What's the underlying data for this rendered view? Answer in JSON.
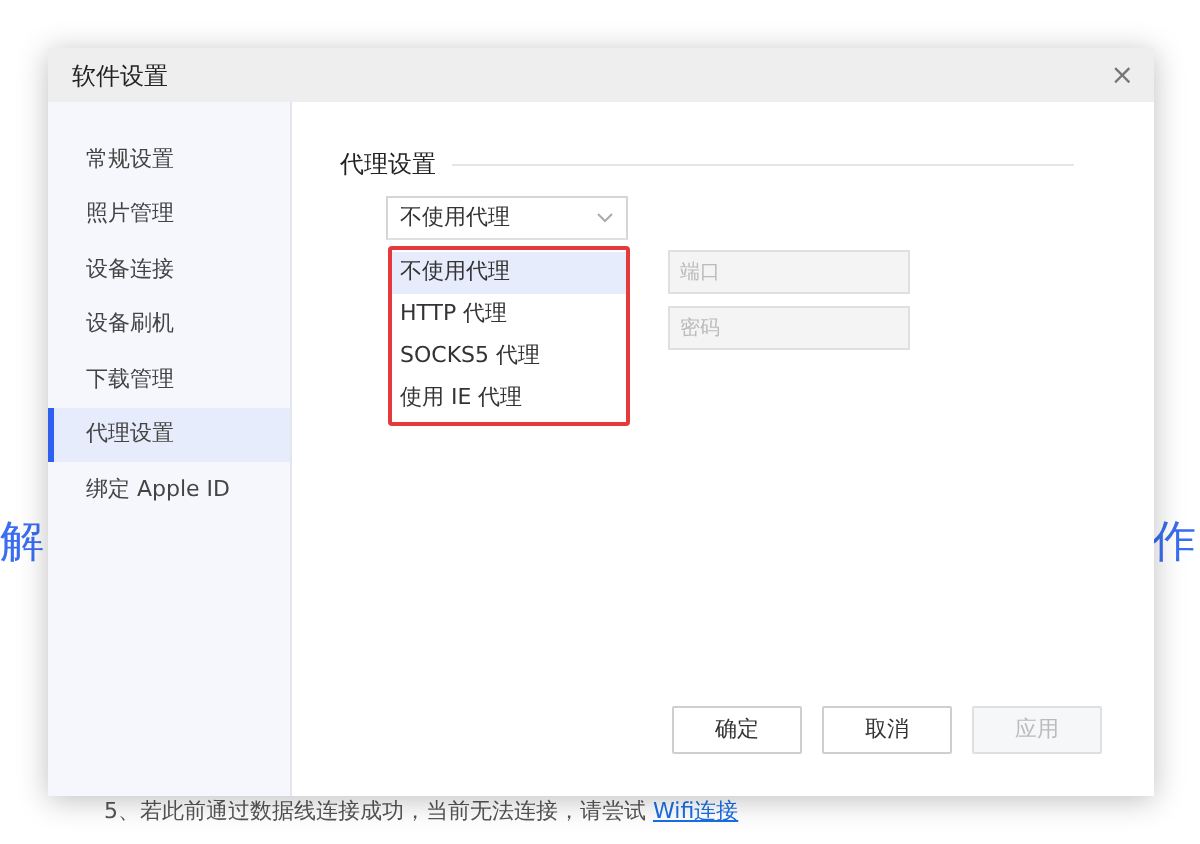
{
  "background": {
    "headline_left": "解",
    "headline_right": "作",
    "tip": {
      "text": "5、若此前通过数据线连接成功，当前无法连接，请尝试",
      "link": "Wifi连接"
    }
  },
  "dialog": {
    "title": "软件设置",
    "close": "×",
    "sidebar": [
      {
        "label": "常规设置",
        "selected": false
      },
      {
        "label": "照片管理",
        "selected": false
      },
      {
        "label": "设备连接",
        "selected": false
      },
      {
        "label": "设备刷机",
        "selected": false
      },
      {
        "label": "下载管理",
        "selected": false
      },
      {
        "label": "代理设置",
        "selected": true
      },
      {
        "label": "绑定 Apple ID",
        "selected": false
      }
    ],
    "section_title": "代理设置",
    "proxy_select": {
      "value": "不使用代理",
      "expanded": true,
      "options": [
        {
          "label": "不使用代理",
          "selected": true
        },
        {
          "label": "HTTP 代理",
          "selected": false
        },
        {
          "label": "SOCKS5 代理",
          "selected": false
        },
        {
          "label": "使用 IE 代理",
          "selected": false
        }
      ]
    },
    "fields": [
      {
        "placeholder": "端口",
        "disabled": true
      },
      {
        "placeholder": "密码",
        "disabled": true
      }
    ],
    "buttons": [
      {
        "label": "确定",
        "disabled": false
      },
      {
        "label": "取消",
        "disabled": false
      },
      {
        "label": "应用",
        "disabled": true
      }
    ]
  }
}
